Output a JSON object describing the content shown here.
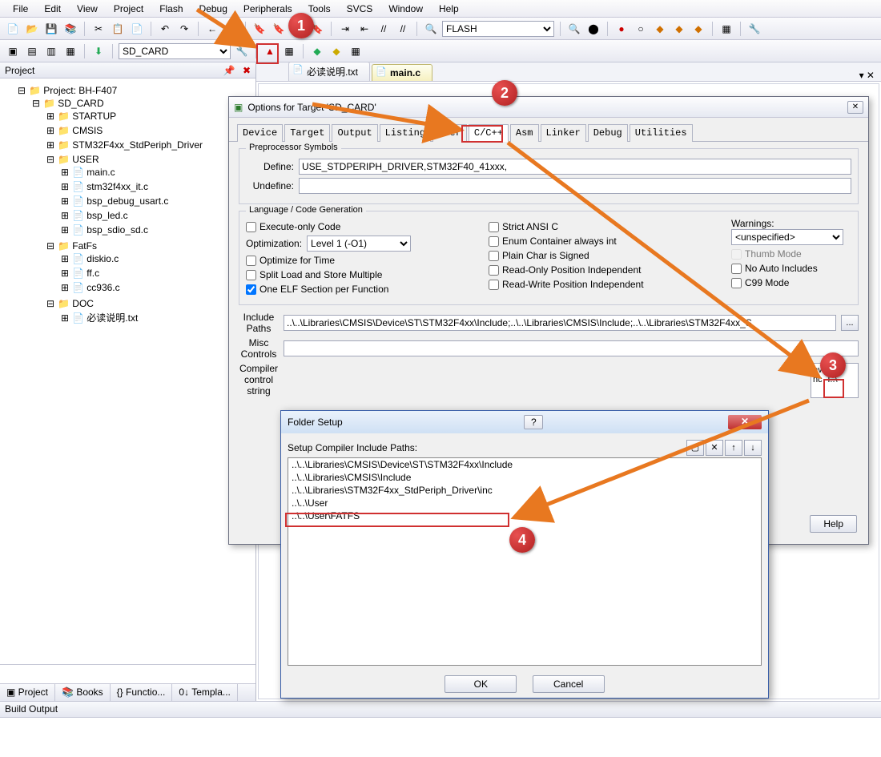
{
  "menu": [
    "File",
    "Edit",
    "View",
    "Project",
    "Flash",
    "Debug",
    "Peripherals",
    "Tools",
    "SVCS",
    "Window",
    "Help"
  ],
  "toolbar1_combo": "FLASH",
  "toolbar2_combo": "SD_CARD",
  "project_pane_title": "Project",
  "tree": {
    "root": "Project: BH-F407",
    "target": "SD_CARD",
    "groups": [
      {
        "name": "STARTUP",
        "files": []
      },
      {
        "name": "CMSIS",
        "files": []
      },
      {
        "name": "STM32F4xx_StdPeriph_Driver",
        "files": []
      },
      {
        "name": "USER",
        "files": [
          "main.c",
          "stm32f4xx_it.c",
          "bsp_debug_usart.c",
          "bsp_led.c",
          "bsp_sdio_sd.c"
        ]
      },
      {
        "name": "FatFs",
        "files": [
          "diskio.c",
          "ff.c",
          "cc936.c"
        ]
      },
      {
        "name": "DOC",
        "files": [
          "必读说明.txt"
        ]
      }
    ]
  },
  "bottom_tabs": [
    "Project",
    "Books",
    "Functio...",
    "Templa..."
  ],
  "editor_tabs": [
    {
      "label": "必读说明.txt",
      "active": false
    },
    {
      "label": "main.c",
      "active": true
    }
  ],
  "build_output_title": "Build Output",
  "options_dialog": {
    "title": "Options for Target 'SD_CARD'",
    "tabs": [
      "Device",
      "Target",
      "Output",
      "Listing",
      "User",
      "C/C++",
      "Asm",
      "Linker",
      "Debug",
      "Utilities"
    ],
    "active_tab": "C/C++",
    "preproc_label": "Preprocessor Symbols",
    "define_label": "Define:",
    "define_value": "USE_STDPERIPH_DRIVER,STM32F40_41xxx,",
    "undefine_label": "Undefine:",
    "undefine_value": "",
    "lang_label": "Language / Code Generation",
    "chk_exec": "Execute-only Code",
    "opt_label": "Optimization:",
    "opt_value": "Level 1 (-O1)",
    "chk_opttime": "Optimize for Time",
    "chk_split": "Split Load and Store Multiple",
    "chk_oneelf": "One ELF Section per Function",
    "chk_strict": "Strict ANSI C",
    "chk_enum": "Enum Container always int",
    "chk_plain": "Plain Char is Signed",
    "chk_ro": "Read-Only Position Independent",
    "chk_rw": "Read-Write Position Independent",
    "warn_label": "Warnings:",
    "warn_value": "<unspecified>",
    "chk_thumb": "Thumb Mode",
    "chk_noauto": "No Auto Includes",
    "chk_c99": "C99 Mode",
    "inc_label": "Include\nPaths",
    "inc_value": "..\\..\\Libraries\\CMSIS\\Device\\ST\\STM32F4xx\\Include;..\\..\\Libraries\\CMSIS\\Include;..\\..\\Libraries\\STM32F4xx_S",
    "misc_label": "Misc\nControls",
    "compctl_label": "Compiler\ncontrol\nstring",
    "compctl_right": "evice\nnc -I..\\",
    "help_btn": "Help"
  },
  "folder_dialog": {
    "title": "Folder Setup",
    "label": "Setup Compiler Include Paths:",
    "paths": [
      "..\\..\\Libraries\\CMSIS\\Device\\ST\\STM32F4xx\\Include",
      "..\\..\\Libraries\\CMSIS\\Include",
      "..\\..\\Libraries\\STM32F4xx_StdPeriph_Driver\\inc",
      "..\\..\\User",
      "..\\..\\User\\FATFS"
    ],
    "ok": "OK",
    "cancel": "Cancel"
  }
}
